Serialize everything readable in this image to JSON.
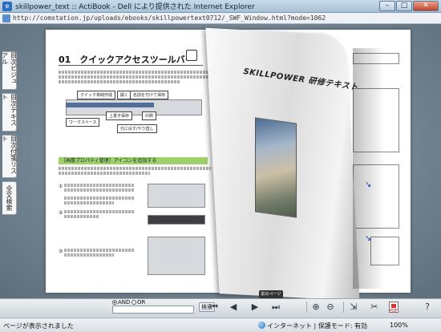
{
  "window": {
    "title": "skillpower_text :: ActiBook - Dell により提供された Internet Explorer",
    "minimize_glyph": "–",
    "maximize_glyph": "□",
    "close_glyph": "✕"
  },
  "address": {
    "url": "http://comstation.jp/uploads/ebooks/skillpowertext0712/_SWF_Window.html?mode=1062"
  },
  "side_tabs": [
    {
      "label": "目次ビジュアル"
    },
    {
      "label": "目次テキスト"
    },
    {
      "label": "目次付箋リスト"
    },
    {
      "label": "全文検索"
    }
  ],
  "left_page": {
    "chapter_title": "01　クイックアクセスツールバー",
    "callouts": [
      "クイック単純作成",
      "開く",
      "名前を付けて保存",
      "ワークスペース",
      "上書き保存",
      "元に戻す/やり直し",
      "印刷"
    ],
    "section_heading": "［画層プロパティ管理］アイコンを追加する",
    "steps": [
      "①",
      "②",
      "③"
    ]
  },
  "right_page": {
    "brand": "SKILLPOWER 研修テキスト"
  },
  "badge": "前のページ",
  "search": {
    "radio_and": "AND",
    "radio_or": "OR",
    "input_value": "",
    "button_label": "検索"
  },
  "toolbar_icons": [
    "first-page-icon",
    "prev-page-icon",
    "next-page-icon",
    "last-page-icon",
    "zoom-in-icon",
    "zoom-out-icon",
    "export-icon",
    "crop-icon",
    "pdf-icon",
    "help-icon"
  ],
  "status": {
    "text": "ページが表示されました",
    "zone": "インターネット | 保護モード: 有効",
    "zoom": "100%"
  }
}
